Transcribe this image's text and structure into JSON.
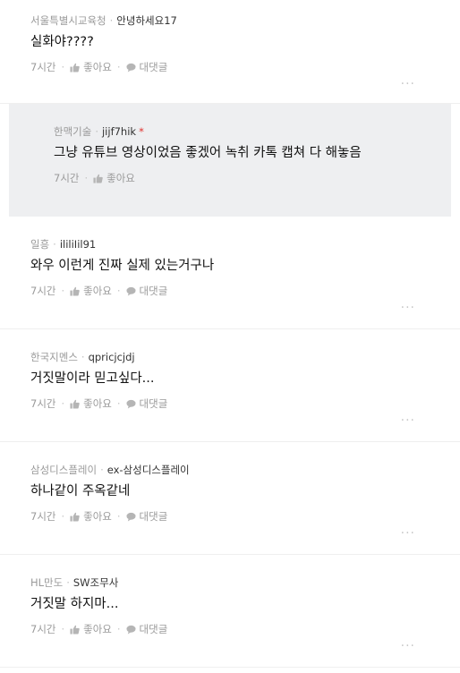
{
  "labels": {
    "like": "좋아요",
    "reply": "대댓글",
    "more": "..."
  },
  "comments": [
    {
      "company": "서울특별시교육청",
      "nickname": "안녕하세요17",
      "text": "실화야????",
      "time": "7시간"
    },
    {
      "company": "한맥기술",
      "nickname": "jijf7hik",
      "text": "그냥 유튜브 영상이었음 좋겠어 녹취 카톡 캡쳐 다 해놓음",
      "time": "7시간",
      "is_reply": true
    },
    {
      "company": "일흥",
      "nickname": "ililiIil91",
      "text": "와우 이런게 진짜 실제 있는거구나",
      "time": "7시간"
    },
    {
      "company": "한국지멘스",
      "nickname": "qpricjcjdj",
      "text": "거짓말이라 믿고싶다...",
      "time": "7시간"
    },
    {
      "company": "삼성디스플레이",
      "nickname": "ex-삼성디스플레이",
      "text": "하나같이 주옥같네",
      "time": "7시간"
    },
    {
      "company": "HL만도",
      "nickname": "SW조무사",
      "text": "거짓말 하지마...",
      "time": "7시간"
    }
  ],
  "icons": {
    "like": "thumbs-up-icon",
    "reply": "speech-bubble-icon",
    "author_marker": "*"
  },
  "colors": {
    "reply_bg": "#eeeff1",
    "author_marker": "#e0302d",
    "meta": "#9a9a9a"
  }
}
